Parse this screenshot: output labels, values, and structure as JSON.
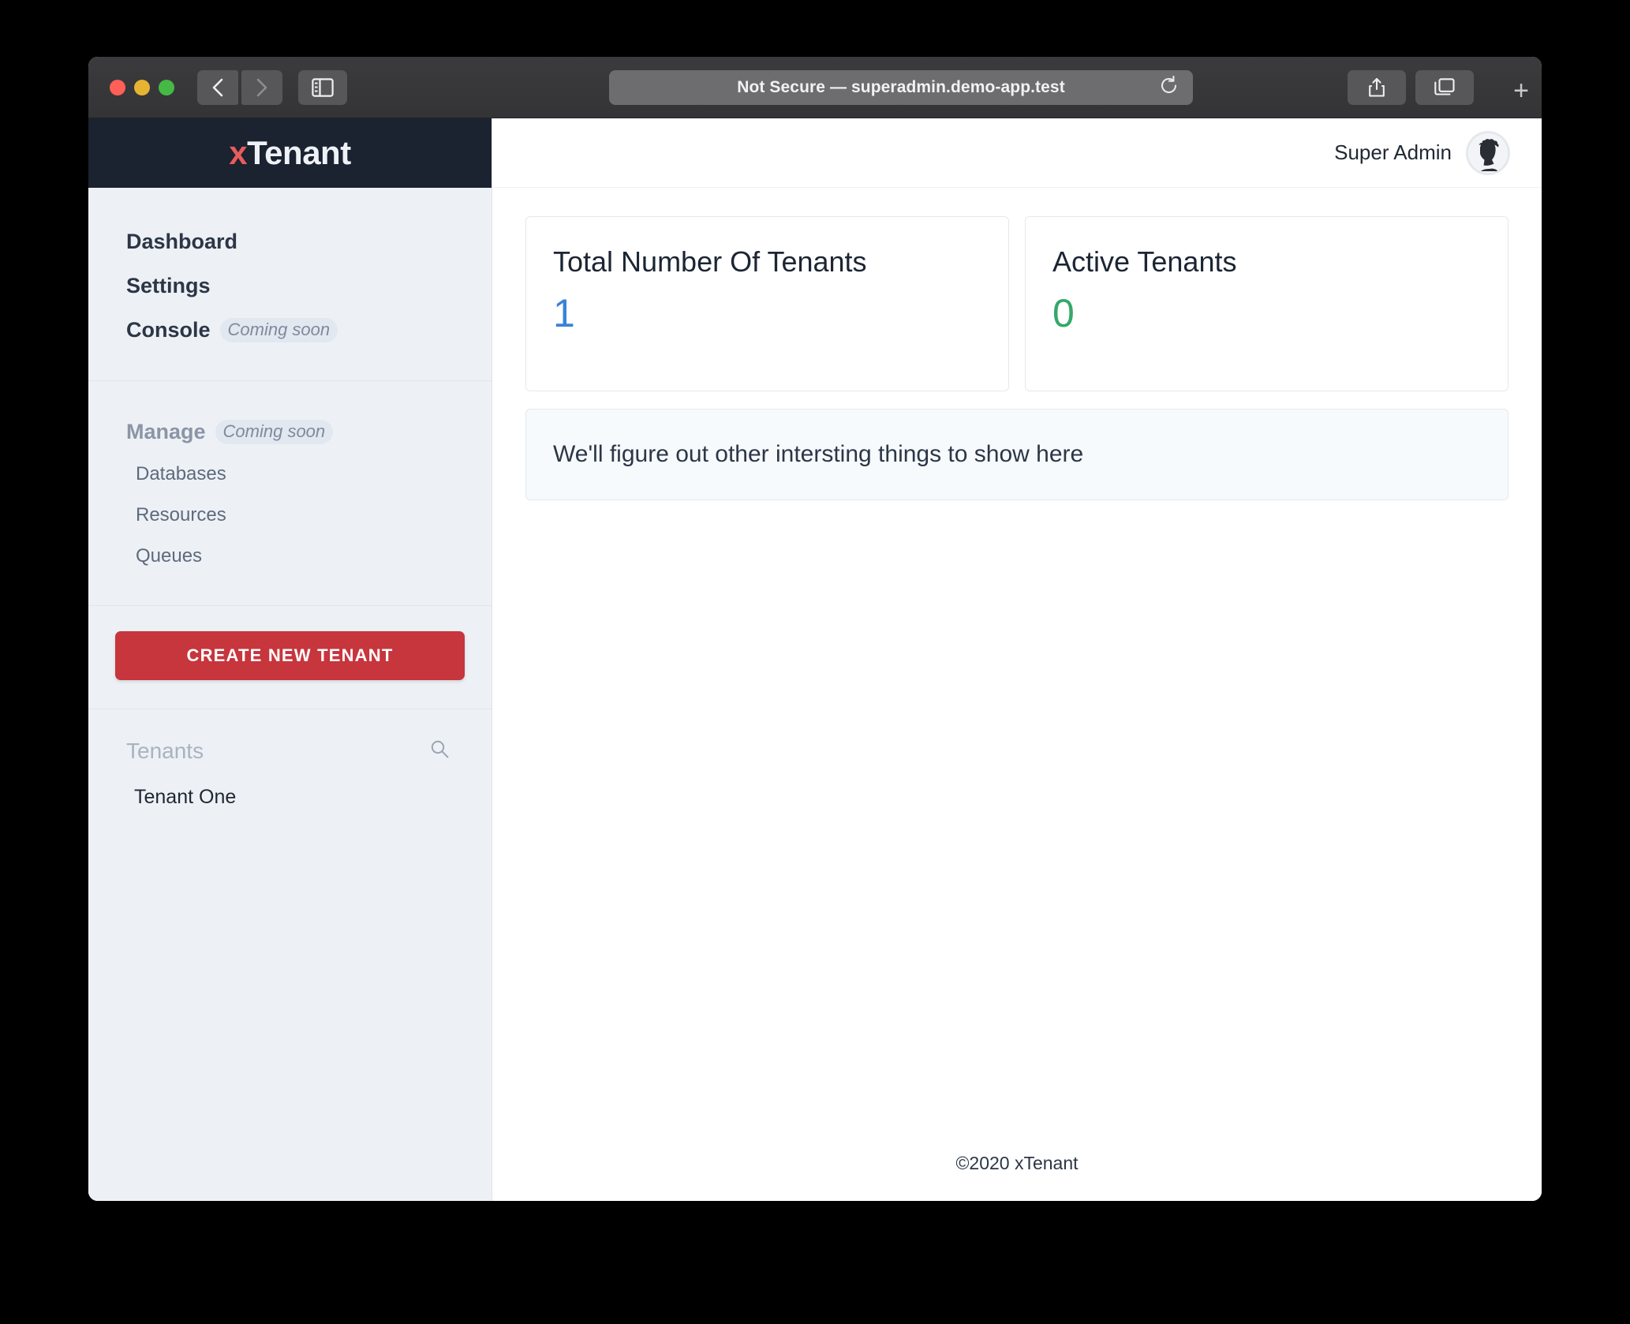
{
  "browser": {
    "url_text": "Not Secure — superadmin.demo-app.test",
    "back_icon": "chevron-left-icon",
    "forward_icon": "chevron-right-icon",
    "sidebar_icon": "sidebar-toggle-icon",
    "reload_icon": "reload-icon",
    "share_icon": "share-icon",
    "tabs_icon": "tab-overview-icon",
    "new_tab_label": "+"
  },
  "app": {
    "logo_x": "x",
    "logo_rest": "Tenant",
    "footer": "©2020 xTenant"
  },
  "topbar": {
    "username": "Super Admin",
    "avatar_icon": "user-avatar"
  },
  "sidebar": {
    "primary": [
      {
        "label": "Dashboard",
        "badge": ""
      },
      {
        "label": "Settings",
        "badge": ""
      },
      {
        "label": "Console",
        "badge": "Coming soon"
      }
    ],
    "manage": {
      "label": "Manage",
      "badge": "Coming soon"
    },
    "manage_items": [
      {
        "label": "Databases"
      },
      {
        "label": "Resources"
      },
      {
        "label": "Queues"
      }
    ],
    "cta_label": "CREATE NEW TENANT",
    "tenants_title": "Tenants",
    "search_icon": "search-icon",
    "tenants": [
      {
        "label": "Tenant One"
      }
    ]
  },
  "main": {
    "cards": [
      {
        "title": "Total Number Of Tenants",
        "value": "1",
        "color": "#3b82d8"
      },
      {
        "title": "Active Tenants",
        "value": "0",
        "color": "#34a86a"
      }
    ],
    "info_text": "We'll figure out other intersting things to show here"
  }
}
